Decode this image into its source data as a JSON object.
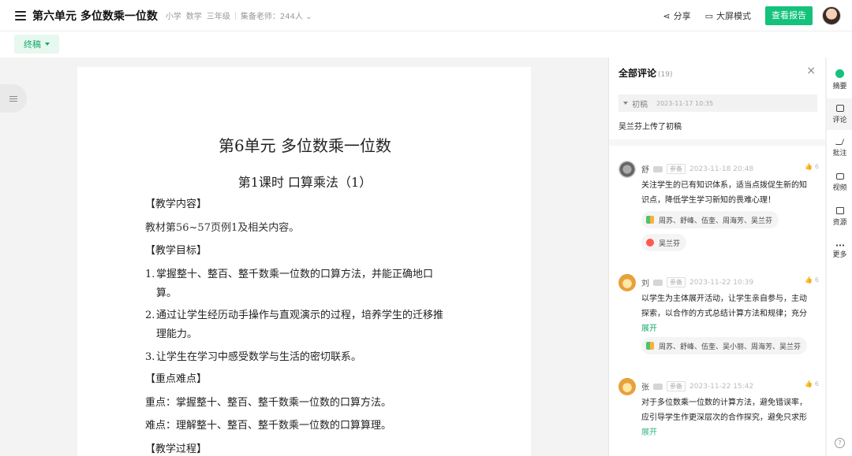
{
  "header": {
    "title": "第六单元 多位数乘一位数",
    "meta": [
      "小学",
      "数学",
      "三年级"
    ],
    "teachers": "集备老师：244人",
    "share_label": "分享",
    "screen_label": "大屏模式",
    "report_label": "查看报告"
  },
  "status": {
    "label": "终稿"
  },
  "document": {
    "title": "第6单元  多位数乘一位数",
    "lesson": "第1课时    口算乘法（1）",
    "sec_content": "【教学内容】",
    "content_text": "教材第56~57页例1及相关内容。",
    "sec_goals": "【教学目标】",
    "goals": [
      {
        "num": "1.",
        "line1": "掌握整十、整百、整千数乘一位数的口算方法，并能正确地口",
        "line2": "算。"
      },
      {
        "num": "2.",
        "line1": "通过让学生经历动手操作与直观演示的过程，培养学生的迁移推",
        "line2": "理能力。"
      },
      {
        "num": "3.",
        "line1": "让学生在学习中感受数学与生活的密切联系。",
        "line2": ""
      }
    ],
    "sec_key": "【重点难点】",
    "key_point": "重点：掌握整十、整百、整千数乘一位数的口算方法。",
    "hard_point": "难点：理解整十、整百、整千数乘一位数的口算算理。",
    "sec_process": "【教学过程】"
  },
  "comments_panel": {
    "title": "全部评论",
    "count": "(19)",
    "close": "×",
    "draft_label": "初稿",
    "draft_date": "2023-11-17 10:35",
    "upload_note": "吴兰芬上传了初稿",
    "comments": [
      {
        "name": "舒",
        "role": "参备",
        "date": "2023-11-18 20:48",
        "likes": "6",
        "line1": "关注学生的已有知识体系，适当点拨促生新的知",
        "line2": "识点，降低学生学习新知的畏难心理！",
        "more": "",
        "react1": "周苏、舒峰、伍奎、周海芳、吴兰芬",
        "react2": "吴兰芬"
      },
      {
        "name": "刘",
        "role": "参备",
        "date": "2023-11-22 10:39",
        "likes": "6",
        "line1": "以学生为主体展开活动，让学生亲自参与，主动",
        "line2": "探索，以合作的方式总结计算方法和规律；充分",
        "more": "展开",
        "react1": "周苏、舒峰、伍奎、吴小丽、周海芳、吴兰芬"
      },
      {
        "name": "张",
        "role": "参备",
        "date": "2023-11-22 15:42",
        "likes": "6",
        "line1": "对于多位数乘一位数的计算方法，避免错误率，",
        "line2": "应引导学生作更深层次的合作探究，避免只求形",
        "more": "展开"
      }
    ]
  },
  "rail": [
    {
      "label": "摘要",
      "icon": "summary-icon"
    },
    {
      "label": "评论",
      "icon": "comment-icon"
    },
    {
      "label": "批注",
      "icon": "annotate-icon"
    },
    {
      "label": "视频",
      "icon": "video-icon"
    },
    {
      "label": "资源",
      "icon": "folder-icon"
    },
    {
      "label": "更多",
      "icon": "more-icon"
    }
  ],
  "help": "?",
  "colors": {
    "accent": "#14c27c",
    "accent_text": "#14a86c"
  }
}
